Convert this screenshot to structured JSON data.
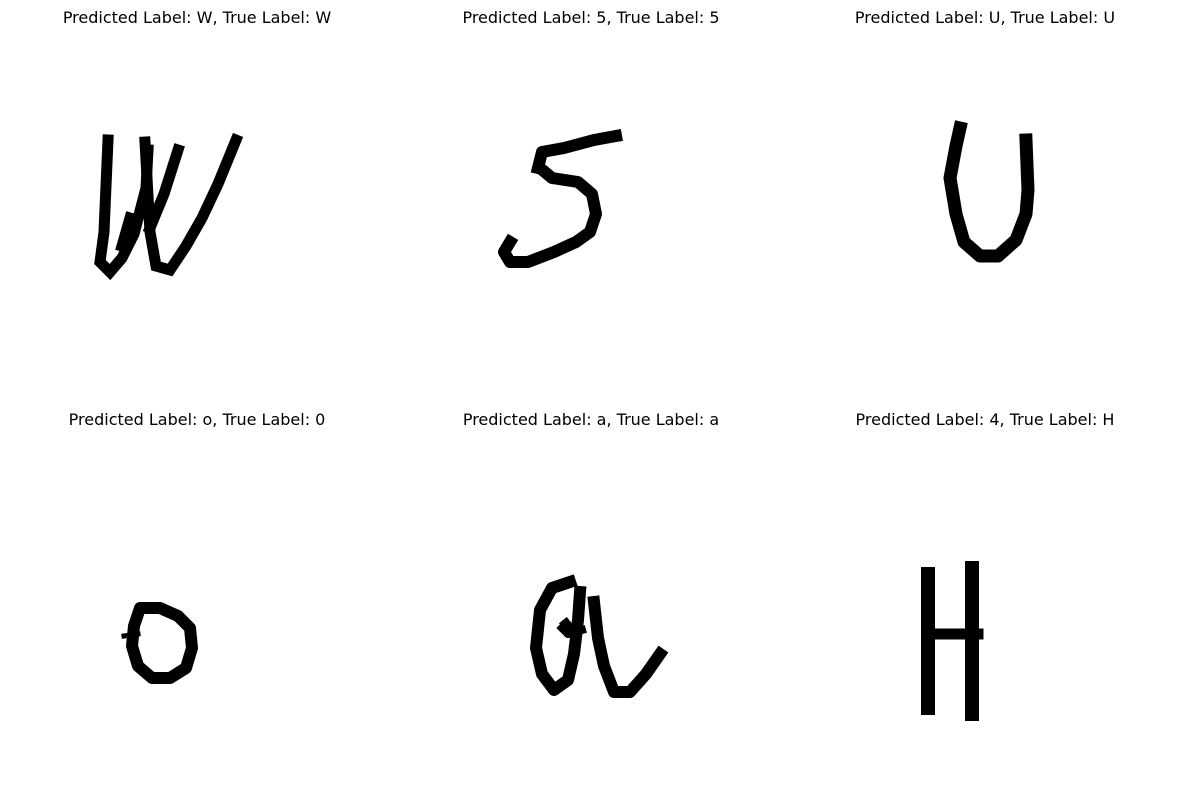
{
  "figure": {
    "panels": [
      {
        "title": "Predicted Label: W, True Label: W",
        "depicts": "handwritten-W",
        "predicted": "W",
        "true": "W"
      },
      {
        "title": "Predicted Label: 5, True Label: 5",
        "depicts": "handwritten-5",
        "predicted": "5",
        "true": "5"
      },
      {
        "title": "Predicted Label: U, True Label: U",
        "depicts": "handwritten-U",
        "predicted": "U",
        "true": "U"
      },
      {
        "title": "Predicted Label: o, True Label: 0",
        "depicts": "handwritten-o",
        "predicted": "o",
        "true": "0"
      },
      {
        "title": "Predicted Label: a, True Label: a",
        "depicts": "handwritten-a",
        "predicted": "a",
        "true": "a"
      },
      {
        "title": "Predicted Label: 4, True Label: H",
        "depicts": "handwritten-H",
        "predicted": "4",
        "true": "H"
      }
    ]
  }
}
